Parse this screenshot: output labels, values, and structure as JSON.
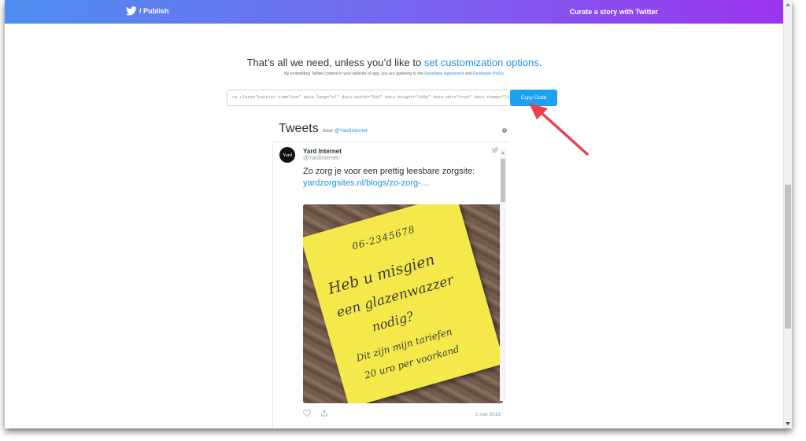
{
  "header": {
    "brand": "/ Publish",
    "link": "Curate a story with Twitter"
  },
  "intro": {
    "headline_prefix": "That’s all we need, unless you’d like to ",
    "headline_link": "set customization options",
    "headline_suffix": ".",
    "sub_prefix": "By embedding Twitter content in your website or app, you are agreeing to the ",
    "sub_link1": "Developer Agreement",
    "sub_and": " and ",
    "sub_link2": "Developer Policy",
    "sub_suffix": "."
  },
  "embed": {
    "code": "<a class=\"twitter-timeline\" data-lang=\"nl\" data-width=\"500\" data-height=\"1000\" data-dnt=\"true\" data-theme=\"light\" href=\"https://twitter.com/YardInternet\">",
    "copy_label": "Copy Code"
  },
  "timeline": {
    "title": "Tweets",
    "by_prefix": "door ",
    "by_handle": "@YardInternet"
  },
  "tweet": {
    "avatar_text": "Yard",
    "author": "Yard Internet",
    "handle": "@YardInternet",
    "text": "Zo zorg je voor een prettig leesbare zorgsite:",
    "link": "yardzorgsites.nl/blogs/zo-zorg-…",
    "date": "2 mei 2019",
    "note_lines": [
      "06-2345678",
      "Heb u misgien",
      "een glazenwazzer",
      "nodig?",
      "Dit zijn mijn tariefen",
      "20 uro per voorkand"
    ]
  },
  "colors": {
    "accent": "#1da1f2",
    "header_start": "#4d8ef0",
    "header_end": "#9b33ee",
    "arrow": "#e8414d",
    "note": "#f4e84a"
  },
  "icons": [
    "twitter-bird-icon",
    "info-icon",
    "heart-icon",
    "share-icon",
    "arrow-annotation"
  ]
}
